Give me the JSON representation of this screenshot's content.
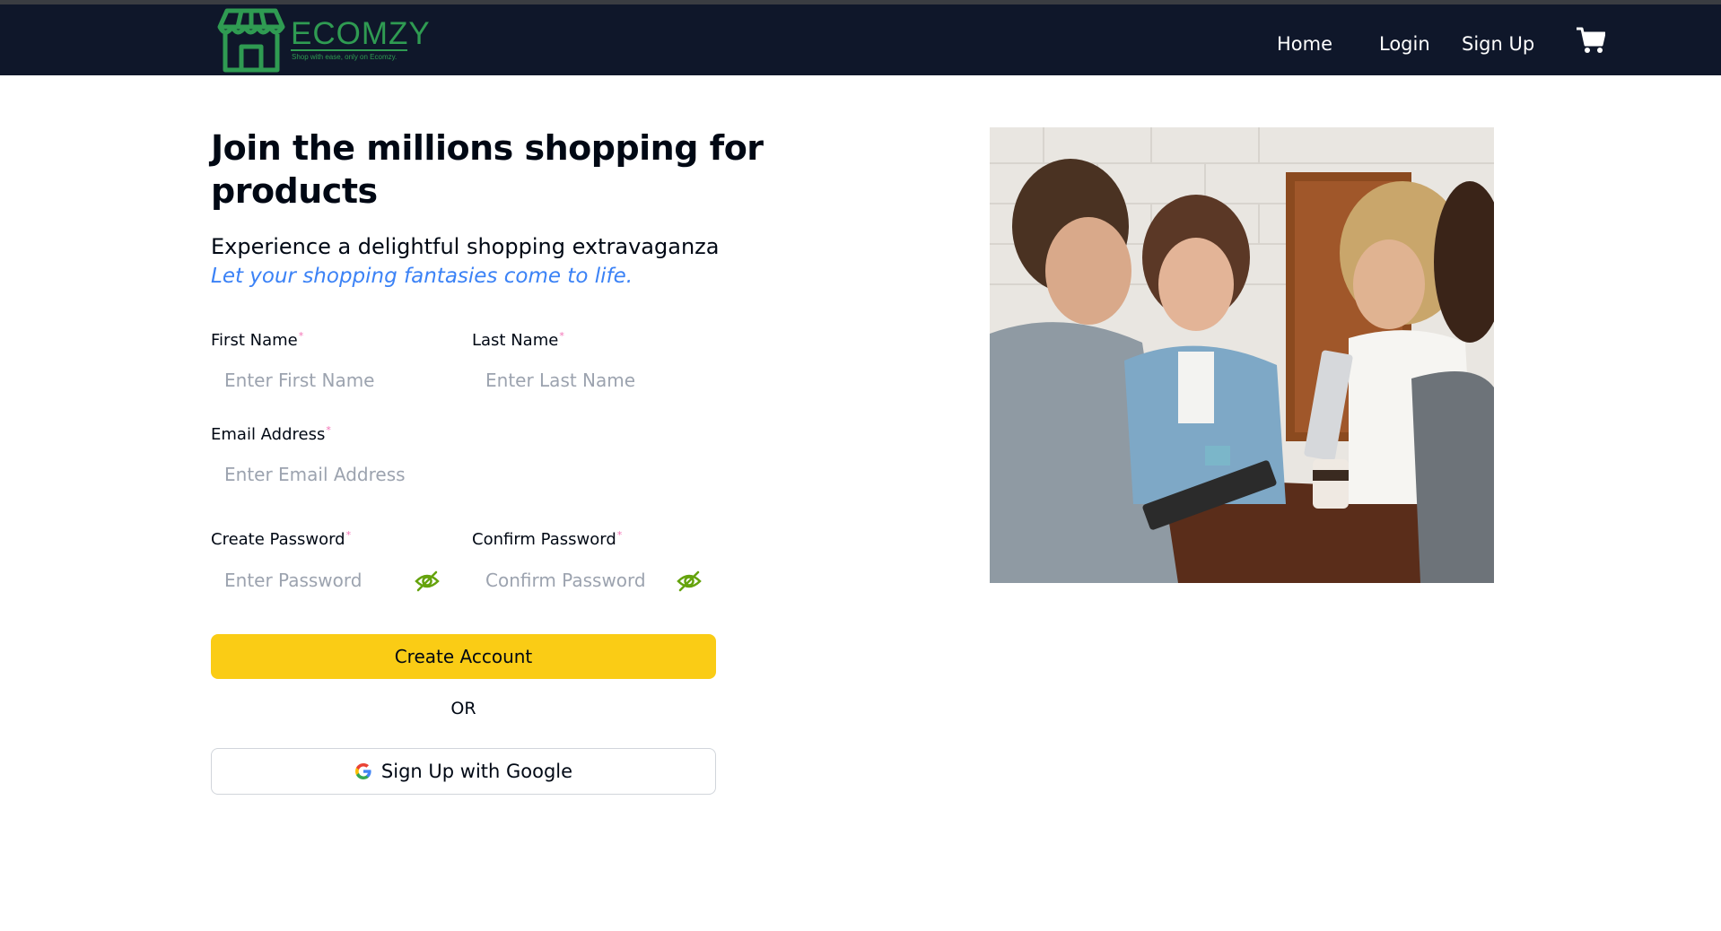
{
  "brand": {
    "name": "ECOMZY",
    "tagline": "Shop with ease, only on Ecomzy."
  },
  "nav": {
    "home": "Home",
    "login": "Login",
    "signup": "Sign Up",
    "cart_icon": "cart-icon"
  },
  "hero": {
    "heading": "Join the millions shopping for products",
    "subtitle": "Experience a delightful shopping extravaganza",
    "tagline": "Let your shopping fantasies come to life."
  },
  "form": {
    "first_name_label": "First Name",
    "first_name_placeholder": "Enter First Name",
    "last_name_label": "Last Name",
    "last_name_placeholder": "Enter Last Name",
    "email_label": "Email Address",
    "email_placeholder": "Enter Email Address",
    "password_label": "Create Password",
    "password_placeholder": "Enter Password",
    "confirm_label": "Confirm Password",
    "confirm_placeholder": "Confirm Password",
    "required_mark": "*",
    "submit_label": "Create Account",
    "or_text": "OR",
    "google_label": "Sign Up with Google"
  },
  "colors": {
    "navbar": "#0f172a",
    "brand_green": "#2f9b52",
    "accent_yellow": "#facc15",
    "tagline_blue": "#3b82f6",
    "eye_icon_green": "#65a30d"
  }
}
